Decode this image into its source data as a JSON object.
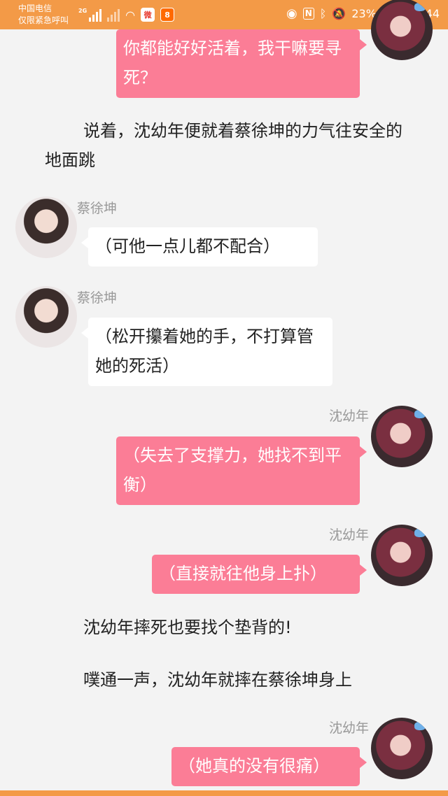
{
  "status_bar": {
    "carrier_line1": "中国电信",
    "carrier_line2": "仅限紧急呼叫",
    "network_badge": "2G",
    "battery_text": "23%",
    "battery_level": 0.23,
    "time": "13:44",
    "nfc_label": "N",
    "icons": [
      "signal-icon",
      "signal-off-icon",
      "wifi-icon",
      "weibo-app-icon",
      "app-icon",
      "eye-comfort-icon",
      "nfc-icon",
      "bluetooth-icon",
      "mute-icon",
      "battery-icon"
    ]
  },
  "messages": [
    {
      "type": "right",
      "text": "你都能好好活着，我干嘛要寻死？"
    },
    {
      "type": "narration",
      "text": "说着，沈幼年便就着蔡徐坤的力气往安全的地面跳"
    },
    {
      "type": "left",
      "name": "蔡徐坤",
      "text": "（可他一点儿都不配合）"
    },
    {
      "type": "left",
      "name": "蔡徐坤",
      "text": "（松开攥着她的手，不打算管她的死活）"
    },
    {
      "type": "right",
      "name": "沈幼年",
      "text": "（失去了支撑力，她找不到平衡）"
    },
    {
      "type": "right",
      "name": "沈幼年",
      "text": "（直接就往他身上扑）"
    },
    {
      "type": "narration",
      "text": "沈幼年摔死也要找个垫背的!"
    },
    {
      "type": "narration",
      "text": "噗通一声，沈幼年就摔在蔡徐坤身上"
    },
    {
      "type": "right",
      "name": "沈幼年",
      "text": "（她真的没有很痛）"
    }
  ],
  "colors": {
    "status_bar": "#f39a47",
    "right_bubble": "#fb7d96",
    "left_bubble": "#ffffff",
    "background": "#f3f3f3"
  }
}
